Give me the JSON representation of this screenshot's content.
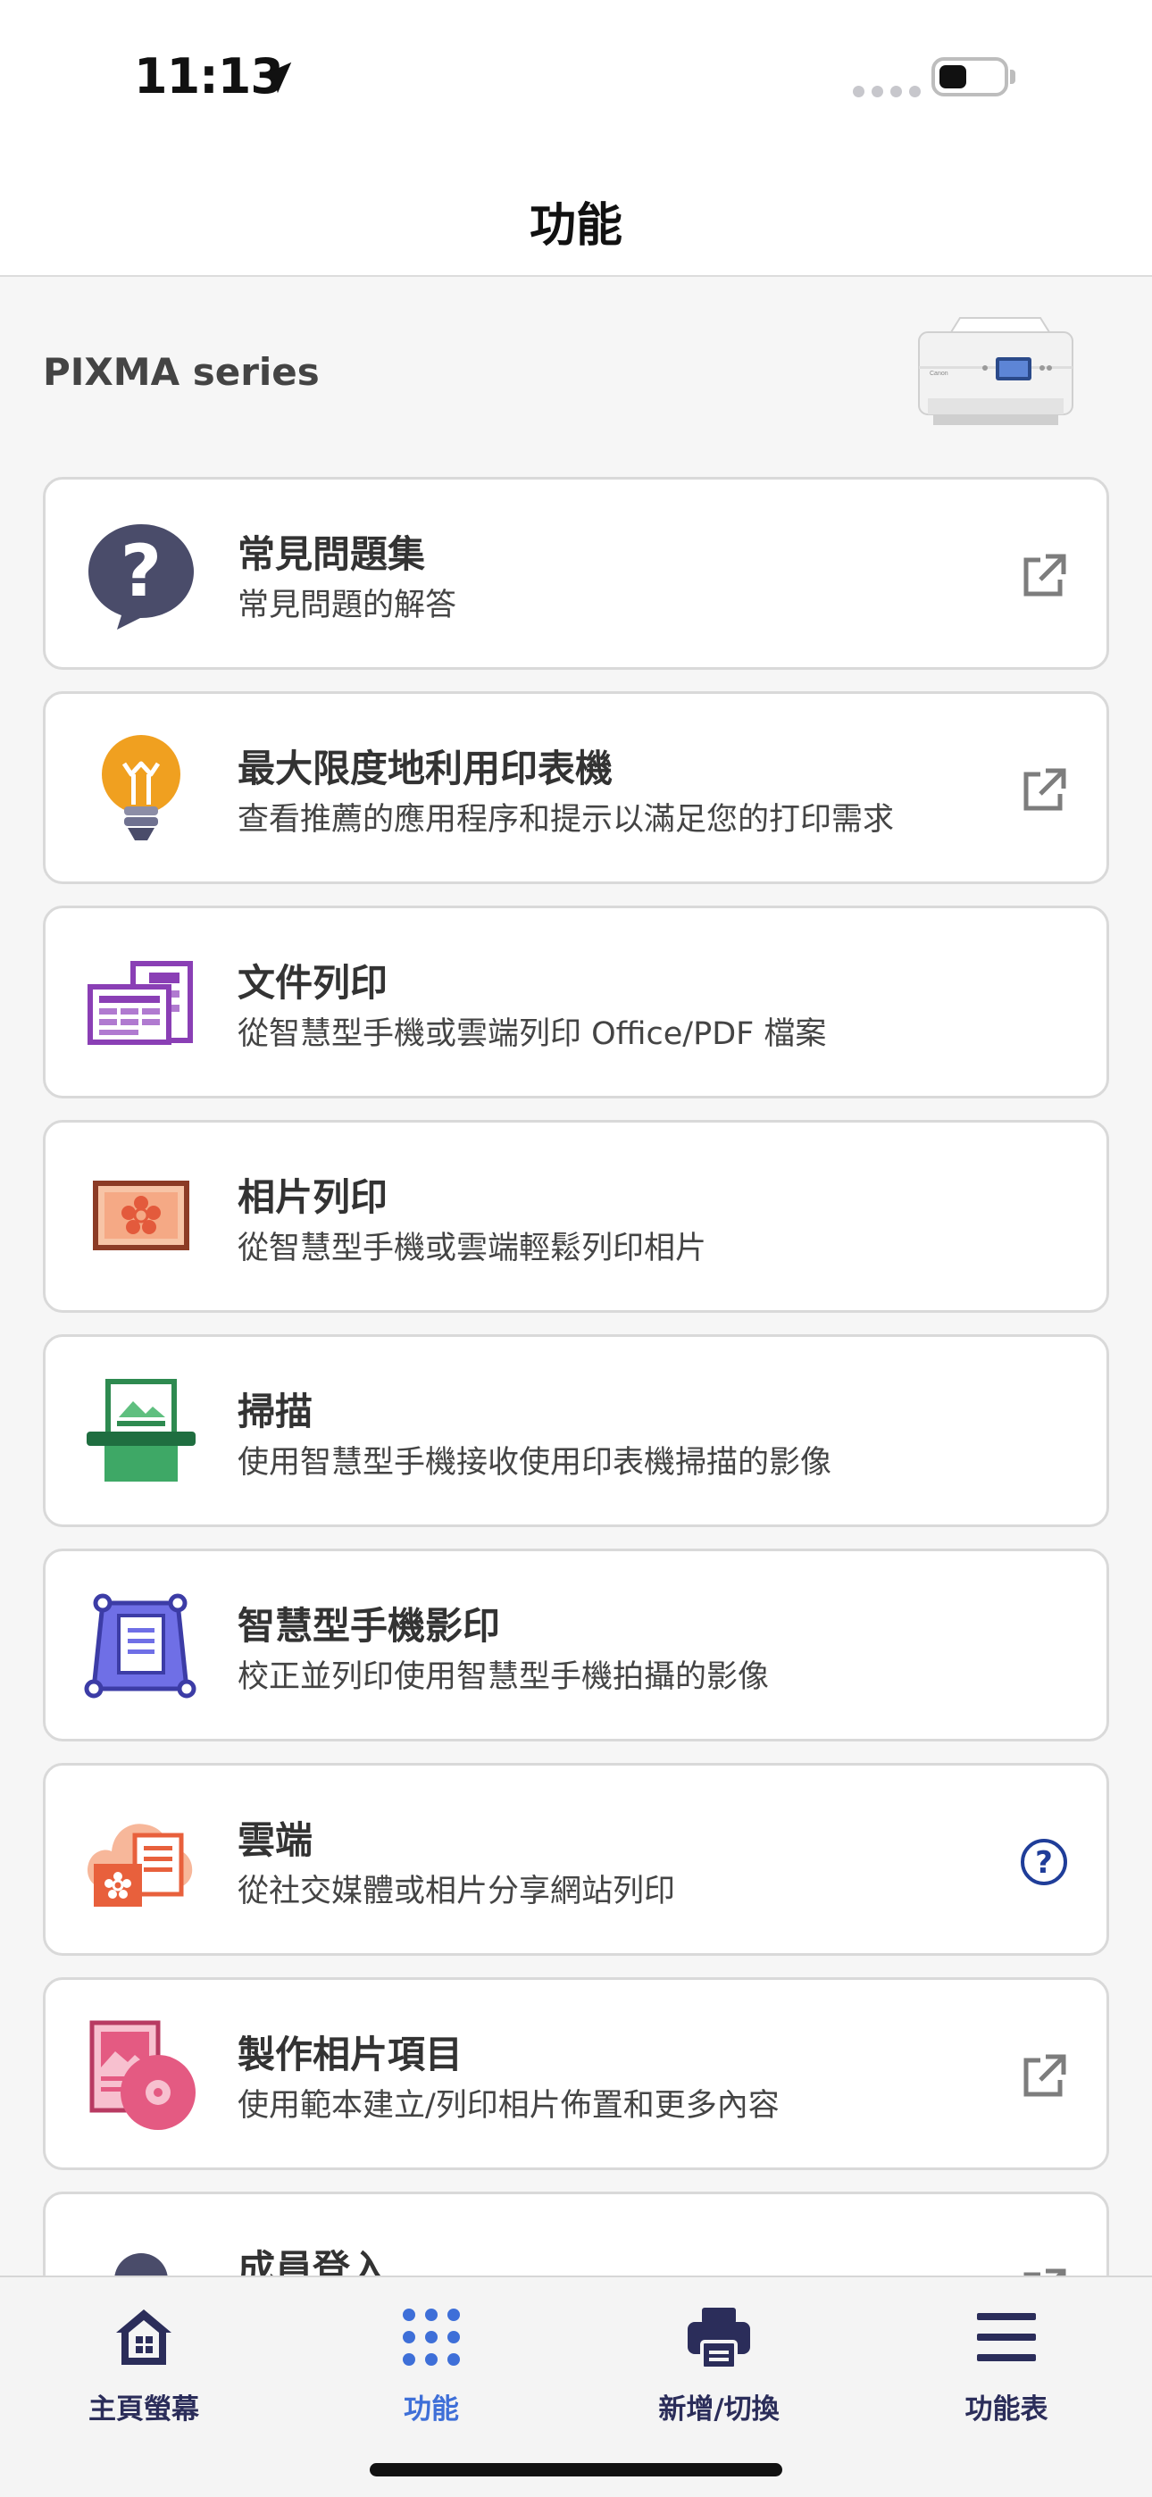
{
  "status_bar": {
    "time": "11:13"
  },
  "header": {
    "title": "功能"
  },
  "printer": {
    "name": "PIXMA series",
    "brand_text": "Canon"
  },
  "menu_items": [
    {
      "title": "常見問題集",
      "subtitle": "常見問題的解答",
      "icon": "faq-question-bubble-icon",
      "trailing": "external-link-icon"
    },
    {
      "title": "最大限度地利用印表機",
      "subtitle": "查看推薦的應用程序和提示以滿足您的打印需求",
      "icon": "lightbulb-icon",
      "trailing": "external-link-icon"
    },
    {
      "title": "文件列印",
      "subtitle": "從智慧型手機或雲端列印 Office/PDF 檔案",
      "icon": "document-print-icon",
      "trailing": ""
    },
    {
      "title": "相片列印",
      "subtitle": "從智慧型手機或雲端輕鬆列印相片",
      "icon": "photo-print-icon",
      "trailing": ""
    },
    {
      "title": "掃描",
      "subtitle": "使用智慧型手機接收使用印表機掃描的影像",
      "icon": "scan-icon",
      "trailing": ""
    },
    {
      "title": "智慧型手機影印",
      "subtitle": "校正並列印使用智慧型手機拍攝的影像",
      "icon": "smartphone-copy-icon",
      "trailing": ""
    },
    {
      "title": "雲端",
      "subtitle": "從社交媒體或相片分享網站列印",
      "icon": "cloud-icon",
      "trailing": "help-circle-icon"
    },
    {
      "title": "製作相片項目",
      "subtitle": "使用範本建立/列印相片佈置和更多內容",
      "icon": "photo-project-icon",
      "trailing": "external-link-icon"
    },
    {
      "title": "成員登入",
      "subtitle": "",
      "icon": "member-icon",
      "trailing": "external-link-icon"
    }
  ],
  "tabs": [
    {
      "label": "主頁螢幕",
      "icon": "home-icon",
      "active": false
    },
    {
      "label": "功能",
      "icon": "grid-dots-icon",
      "active": true
    },
    {
      "label": "新增/切換",
      "icon": "printer-icon",
      "active": false
    },
    {
      "label": "功能表",
      "icon": "hamburger-menu-icon",
      "active": false
    }
  ],
  "colors": {
    "navy": "#2b2d5a",
    "active_blue": "#3e6fd8",
    "help_blue": "#1f3d99",
    "purple": "#8a3fb5",
    "photo_brown": "#8c3b25",
    "scan_green": "#2e9a5a",
    "copy_violet": "#6f6fe6",
    "cloud_orange": "#f08a5d",
    "project_pink": "#e45a82"
  }
}
